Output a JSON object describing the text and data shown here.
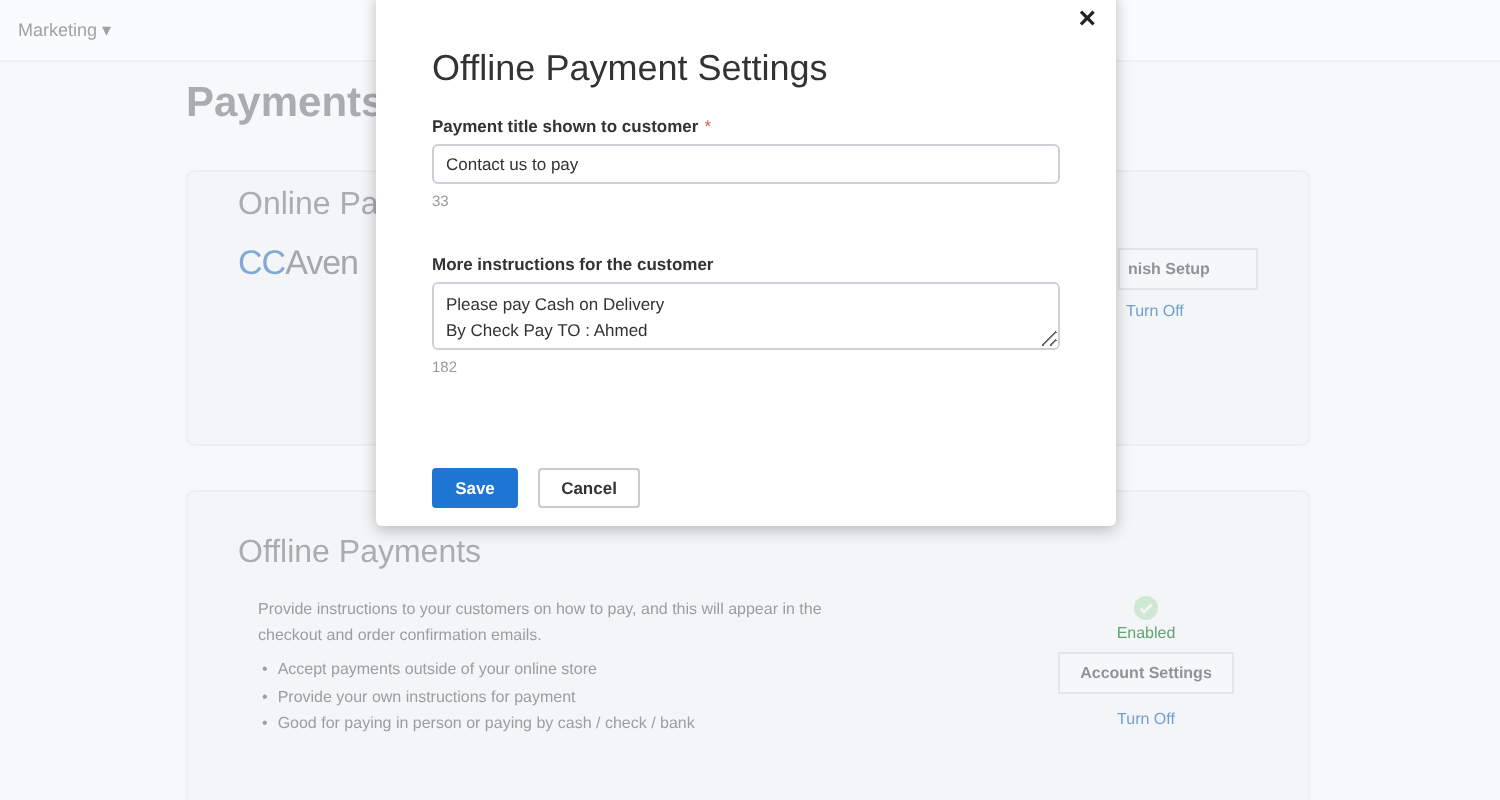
{
  "top_bar": {
    "menu": "Marketing",
    "caret": "▾"
  },
  "page_title": "Payments",
  "online_card": {
    "title": "Online Pa",
    "logo": {
      "mark": "CC",
      "word": "Aven"
    },
    "setup_button": "nish Setup",
    "turn_off": "Turn Off"
  },
  "offline_card": {
    "title": "Offline Payments",
    "description": "Provide instructions to your customers on how to pay, and this will appear in the checkout and order confirmation emails.",
    "bullet_mark": "•",
    "bullets": [
      "Accept payments outside of your online store",
      "Provide your own instructions for payment",
      "Good for paying in person or paying by cash / check / bank"
    ],
    "enabled": true,
    "status": "Enabled",
    "settings_button": "Account Settings",
    "turn_off": "Turn Off"
  },
  "modal": {
    "title": "Offline Payment Settings",
    "close": "×",
    "fields": [
      {
        "kind": "input",
        "label": "Payment title shown to customer",
        "required_mark": "*",
        "value": "Contact us to pay",
        "counter": "33"
      },
      {
        "kind": "textarea",
        "label": "More instructions for the customer",
        "lines": [
          "Please pay Cash on Delivery",
          "By Check Pay TO : Ahmed"
        ],
        "counter": "182"
      }
    ],
    "buttons": [
      {
        "label": "Save",
        "kind": "primary"
      },
      {
        "label": "Cancel",
        "kind": "secondary"
      }
    ]
  }
}
